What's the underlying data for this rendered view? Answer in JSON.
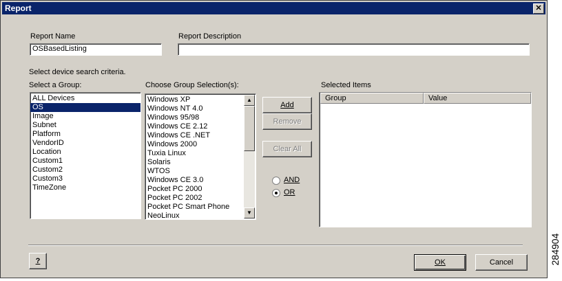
{
  "window": {
    "title": "Report",
    "close_glyph": "✕"
  },
  "report_name": {
    "label": "Report Name",
    "value": "OSBasedListing"
  },
  "report_description": {
    "label": "Report Description",
    "value": ""
  },
  "criteria_label": "Select device search criteria.",
  "group_list": {
    "label": "Select a Group:",
    "items": [
      "ALL Devices",
      "OS",
      "Image",
      "Subnet",
      "Platform",
      "VendorID",
      "Location",
      "Custom1",
      "Custom2",
      "Custom3",
      "TimeZone"
    ],
    "selected_index": 1
  },
  "selection_list": {
    "label": "Choose Group Selection(s):",
    "items": [
      "Windows XP",
      "Windows NT 4.0",
      "Windows 95/98",
      "Windows CE 2.12",
      "Windows CE .NET",
      "Windows 2000",
      "Tuxia Linux",
      "Solaris",
      "WTOS",
      "Windows CE 3.0",
      "Pocket PC 2000",
      "Pocket PC 2002",
      "Pocket PC Smart Phone",
      "NeoLinux"
    ]
  },
  "buttons": {
    "add": "Add",
    "remove": "Remove",
    "clear_all": "Clear All",
    "ok": "OK",
    "cancel": "Cancel",
    "help": "?"
  },
  "logic": {
    "and_label": "AND",
    "or_label": "OR",
    "selected": "OR"
  },
  "selected_items": {
    "label": "Selected Items",
    "columns": [
      "Group",
      "Value"
    ],
    "rows": []
  },
  "figure_id": "284904"
}
